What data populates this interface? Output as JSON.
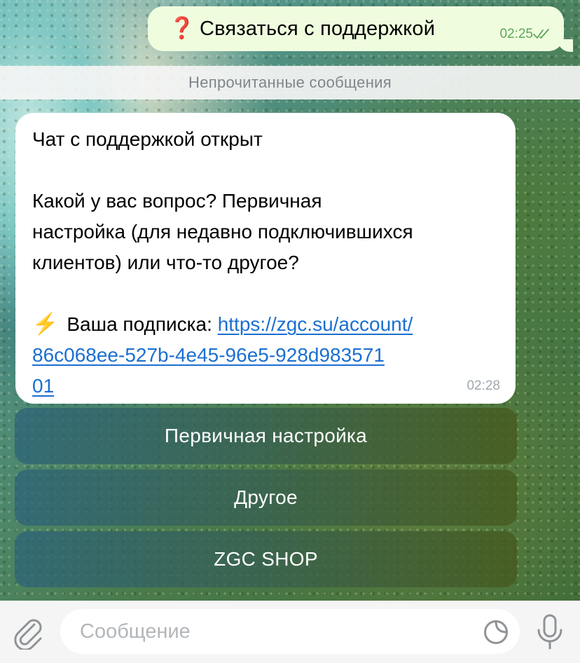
{
  "outgoing": {
    "icon": "question-mark-icon",
    "icon_glyph": "❓",
    "text": "Связаться с поддержкой",
    "time": "02:25",
    "status_icon": "double-check-icon",
    "accent": "#effdde"
  },
  "unread": {
    "label": "Непрочитанные сообщения"
  },
  "incoming": {
    "line1": "Чат с поддержкой открыт",
    "line2": "Какой у вас вопрос? Первичная",
    "line3": "настройка (для недавно подключившихся",
    "line4": "клиентов) или что-то другое?",
    "bolt_glyph": "⚡",
    "subscription_label": "Ваша подписка:",
    "link_part1": "https://zgc.su/account/",
    "link_part2": "86c068ee-527b-4e45-96e5-928d983571",
    "link_part3": "01",
    "time": "02:28",
    "link_color": "#1b6fd1"
  },
  "keyboard": {
    "buttons": [
      {
        "label": "Первичная настройка"
      },
      {
        "label": "Другое"
      },
      {
        "label": "ZGC SHOP"
      }
    ]
  },
  "composer": {
    "placeholder": "Сообщение",
    "attach_icon": "paperclip-icon",
    "sticker_icon": "sticker-icon",
    "mic_icon": "microphone-icon"
  }
}
